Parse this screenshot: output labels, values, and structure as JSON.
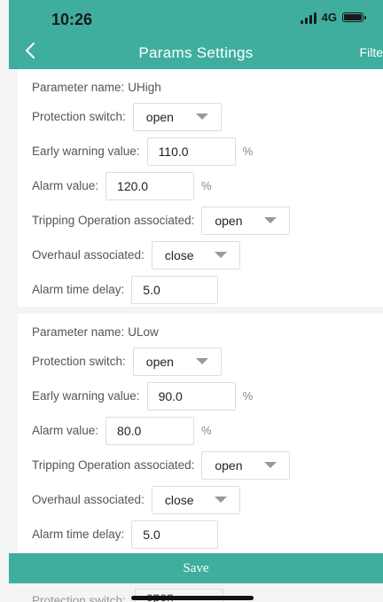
{
  "status_bar": {
    "time": "10:26",
    "network": "4G"
  },
  "nav": {
    "title": "Params Settings",
    "filter": "Filte"
  },
  "labels": {
    "parameter_name": "Parameter name:",
    "protection_switch": "Protection switch:",
    "early_warning_value": "Early warning value:",
    "alarm_value": "Alarm value:",
    "tripping_associated": "Tripping Operation associated:",
    "overhaul_associated": "Overhaul associated:",
    "alarm_time_delay": "Alarm time delay:",
    "percent_unit": "%"
  },
  "params": [
    {
      "name": "UHigh",
      "protection_switch": "open",
      "early_warning_value": "110.0",
      "alarm_value": "120.0",
      "tripping_associated": "open",
      "overhaul_associated": "close",
      "alarm_time_delay": "5.0"
    },
    {
      "name": "ULow",
      "protection_switch": "open",
      "early_warning_value": "90.0",
      "alarm_value": "80.0",
      "tripping_associated": "open",
      "overhaul_associated": "close",
      "alarm_time_delay": "5.0"
    }
  ],
  "save_label": "Save",
  "peek": {
    "label": "Protection switch:",
    "value": "open"
  },
  "colors": {
    "accent": "#3fae9e",
    "card_bg": "#ffffff",
    "page_bg": "#f4f4f4"
  }
}
